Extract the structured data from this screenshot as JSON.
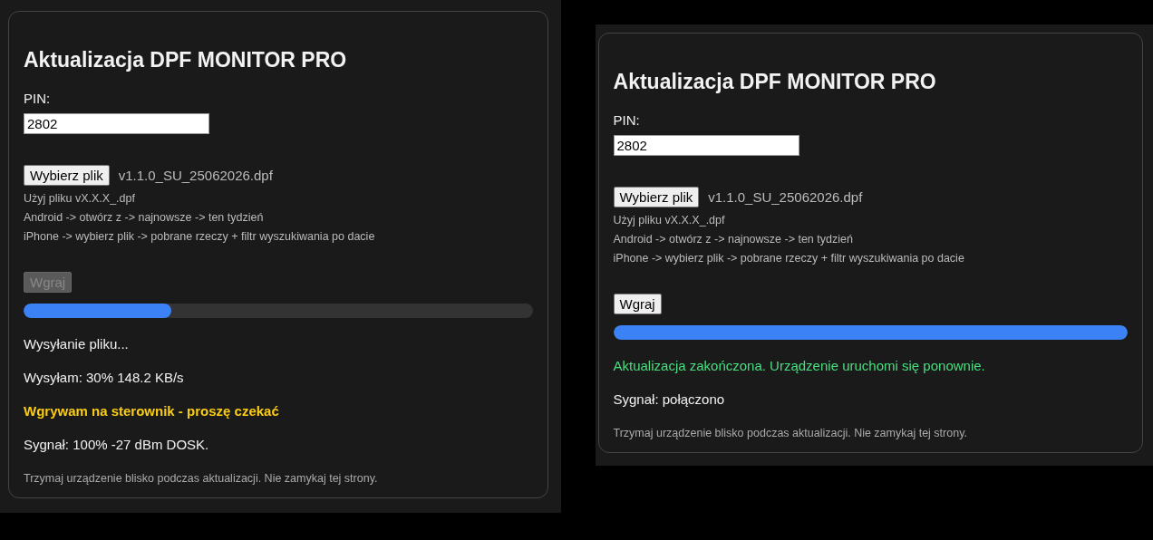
{
  "panels": [
    {
      "title": "Aktualizacja DPF MONITOR PRO",
      "pin_label": "PIN:",
      "pin_value": "2802",
      "file_button": "Wybierz plik",
      "file_name": "v1.1.0_SU_25062026.dpf",
      "hints": [
        "Użyj pliku vX.X.X_.dpf",
        "Android -> otwórz z -> najnowsze -> ten tydzień",
        "iPhone -> wybierz plik -> pobrane rzeczy + filtr wyszukiwania po dacie"
      ],
      "upload_button": {
        "label": "Wgraj",
        "disabled": true
      },
      "progress": {
        "level": 0.29
      },
      "messages": [
        {
          "kind": "plain",
          "text": "Wysyłanie pliku..."
        },
        {
          "kind": "plain",
          "text": "Wysyłam: 30% 148.2 KB/s"
        },
        {
          "kind": "warning",
          "text": "Wgrywam na sterownik - proszę czekać"
        },
        {
          "kind": "plain",
          "text": "Sygnał: 100% -27 dBm DOSK."
        }
      ],
      "footer": "Trzymaj urządzenie blisko podczas aktualizacji. Nie zamykaj tej strony."
    },
    {
      "title": "Aktualizacja DPF MONITOR PRO",
      "pin_label": "PIN:",
      "pin_value": "2802",
      "file_button": "Wybierz plik",
      "file_name": "v1.1.0_SU_25062026.dpf",
      "hints": [
        "Użyj pliku vX.X.X_.dpf",
        "Android -> otwórz z -> najnowsze -> ten tydzień",
        "iPhone -> wybierz plik -> pobrane rzeczy + filtr wyszukiwania po dacie"
      ],
      "upload_button": {
        "label": "Wgraj",
        "disabled": false
      },
      "progress": {
        "level": 1
      },
      "messages": [
        {
          "kind": "success",
          "text": "Aktualizacja zakończona. Urządzenie uruchomi się ponownie."
        },
        {
          "kind": "plain",
          "text": "Sygnał: połączono"
        }
      ],
      "footer": "Trzymaj urządzenie blisko podczas aktualizacji. Nie zamykaj tej strony."
    }
  ]
}
